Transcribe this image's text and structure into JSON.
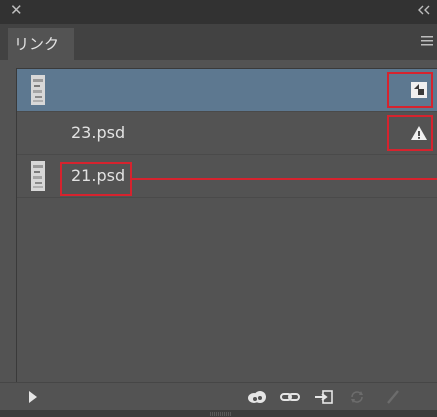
{
  "panel": {
    "tab_label": "リンク"
  },
  "icons": {
    "close": "✕",
    "collapse": "chevrons-left-icon",
    "menu": "hamburger-menu-icon"
  },
  "links": {
    "rows": [
      {
        "filename": "",
        "thumbnail": true,
        "status": "modified-link-icon",
        "selected": true
      },
      {
        "filename": "23.psd",
        "thumbnail": false,
        "status": "warning-icon",
        "selected": false
      },
      {
        "filename": "21.psd",
        "thumbnail": true,
        "status": "",
        "selected": false
      }
    ]
  },
  "toolbar": {
    "items": [
      "play-icon",
      "creative-cloud-icon",
      "relink-icon",
      "go-to-link-icon",
      "update-link-icon",
      "edit-original-icon"
    ]
  },
  "colors": {
    "panel_bg": "#535353",
    "selected_row": "#5d7890",
    "highlight": "#d6232e"
  }
}
